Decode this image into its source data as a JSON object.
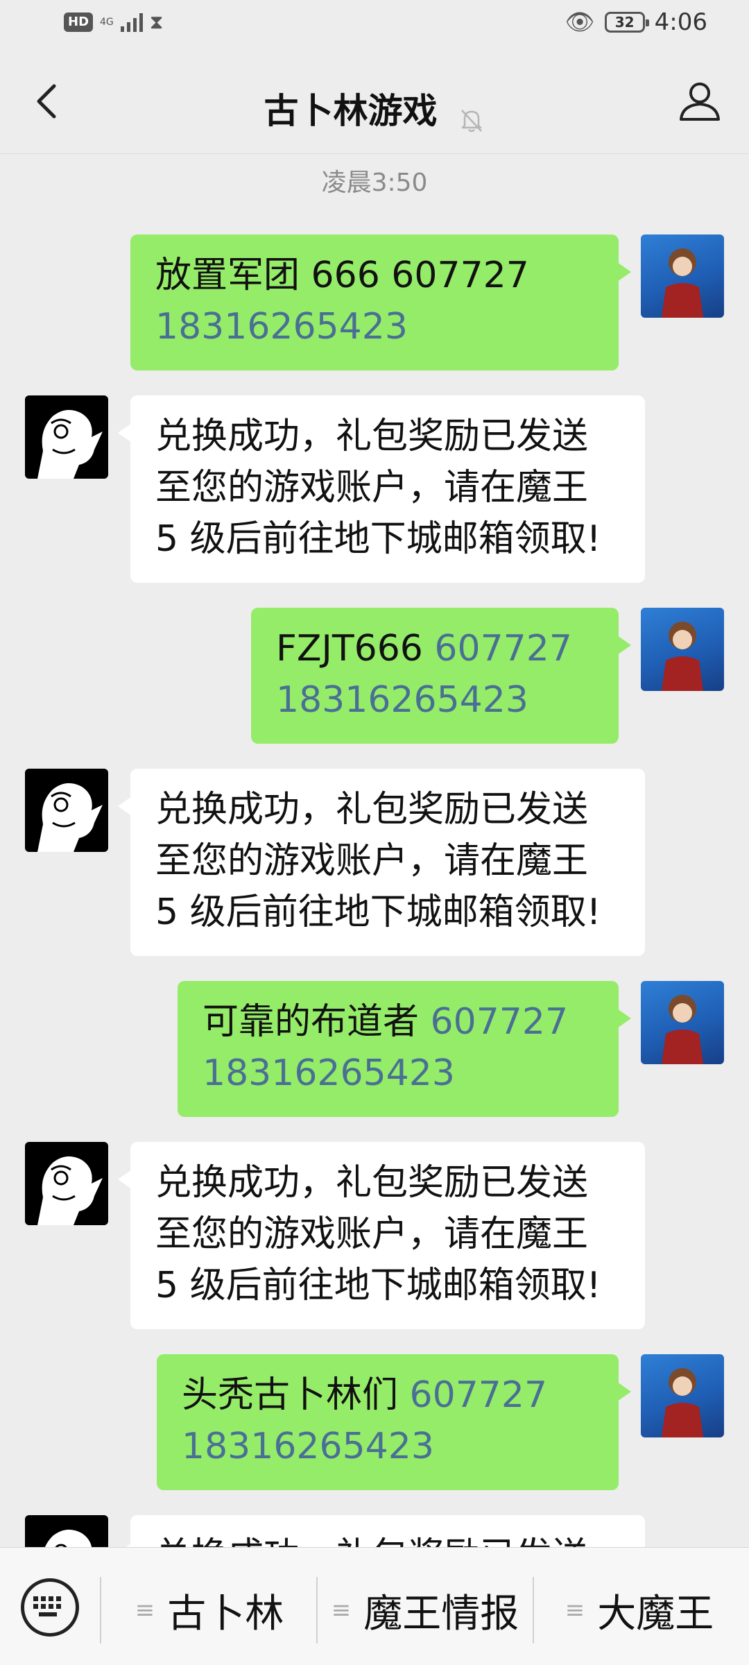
{
  "status_bar": {
    "hd_label": "HD",
    "network_label": "4G",
    "battery_level": "32",
    "time": "4:06"
  },
  "header": {
    "title": "古卜林游戏"
  },
  "chat": {
    "timestamp": "凌晨3:50",
    "messages": [
      {
        "from": "self",
        "line1": "放置军团 666  607727",
        "line1_num": "",
        "line2": "18316265423"
      },
      {
        "from": "bot",
        "lines": [
          "兑换成功，礼包奖励已发送",
          "至您的游戏账户，请在魔王",
          "5 级后前往地下城邮箱领取!"
        ]
      },
      {
        "from": "self",
        "line1": "FZJT666  ",
        "line1_num": "607727",
        "line2": "18316265423"
      },
      {
        "from": "bot",
        "lines": [
          "兑换成功，礼包奖励已发送",
          "至您的游戏账户，请在魔王",
          "5 级后前往地下城邮箱领取!"
        ]
      },
      {
        "from": "self",
        "line1": "可靠的布道者 ",
        "line1_num": "607727",
        "line2": "18316265423"
      },
      {
        "from": "bot",
        "lines": [
          "兑换成功，礼包奖励已发送",
          "至您的游戏账户，请在魔王",
          "5 级后前往地下城邮箱领取!"
        ]
      },
      {
        "from": "self",
        "line1": " 头秃古卜林们  ",
        "line1_num": "607727",
        "line2": "18316265423"
      },
      {
        "from": "bot",
        "lines": [
          "兑换成功，礼包奖励已发送"
        ]
      }
    ]
  },
  "bottom_menu": {
    "items": [
      "古卜林",
      "魔王情报",
      "大魔王"
    ]
  },
  "icons": {
    "back": "back-arrow-icon",
    "mute": "bell-muted-icon",
    "profile": "person-icon",
    "keyboard": "keyboard-icon",
    "menu": "menu-lines-icon"
  }
}
